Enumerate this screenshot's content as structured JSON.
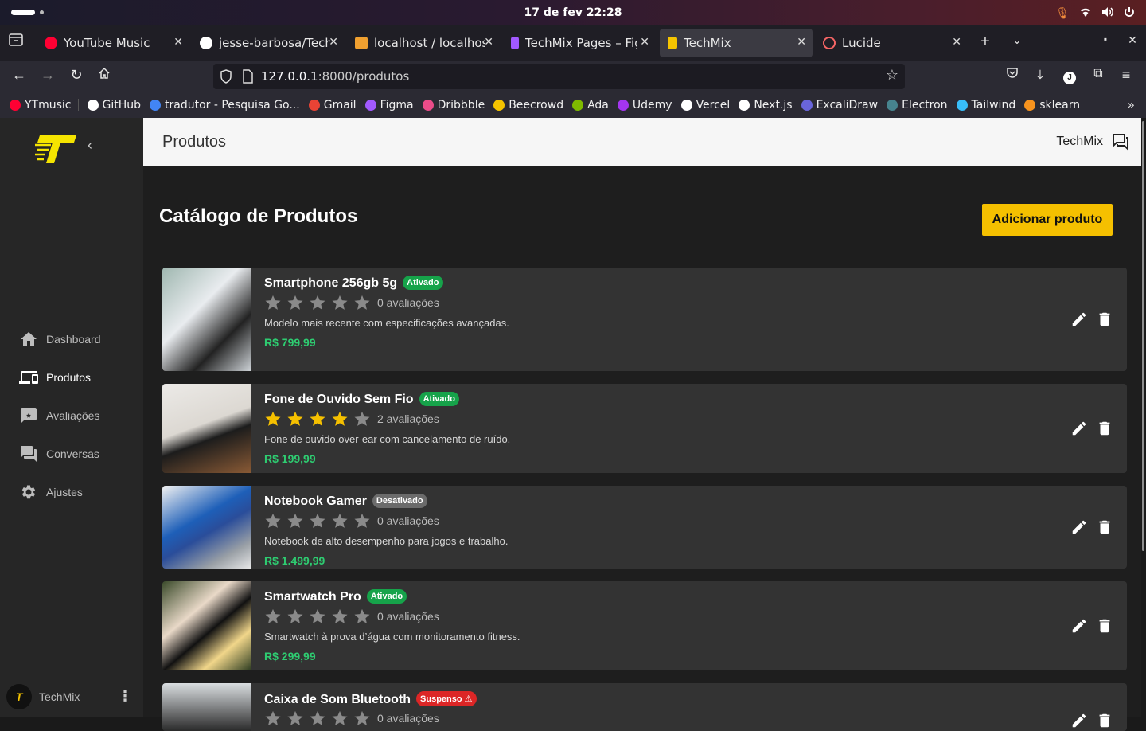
{
  "os_bar": {
    "clock": "17 de fev  22:28"
  },
  "tabs": [
    {
      "title": "YouTube Music",
      "color": "#ff0033"
    },
    {
      "title": "jesse-barbosa/TechMix",
      "color": "#ffffff"
    },
    {
      "title": "localhost / localhost / te",
      "color": "#f0a030"
    },
    {
      "title": "TechMix Pages – Figma",
      "color": "#a259ff"
    },
    {
      "title": "TechMix",
      "color": "#f5c400"
    },
    {
      "title": "Lucide",
      "color": "#f56565"
    }
  ],
  "address": {
    "host": "127.0.0.1",
    "path": ":8000/produtos"
  },
  "bookmarks": [
    {
      "label": "YTmusic",
      "color": "#ff0033"
    },
    {
      "label": "GitHub",
      "color": "#ffffff"
    },
    {
      "label": "tradutor - Pesquisa Go...",
      "color": "#4285f4"
    },
    {
      "label": "Gmail",
      "color": "#ea4335"
    },
    {
      "label": "Figma",
      "color": "#a259ff"
    },
    {
      "label": "Dribbble",
      "color": "#ea4c89"
    },
    {
      "label": "Beecrowd",
      "color": "#f5c400"
    },
    {
      "label": "Ada",
      "color": "#7fba00"
    },
    {
      "label": "Udemy",
      "color": "#a435f0"
    },
    {
      "label": "Vercel",
      "color": "#ffffff"
    },
    {
      "label": "Next.js",
      "color": "#ffffff"
    },
    {
      "label": "ExcaliDraw",
      "color": "#6965db"
    },
    {
      "label": "Electron",
      "color": "#47848f"
    },
    {
      "label": "Tailwind",
      "color": "#38bdf8"
    },
    {
      "label": "sklearn",
      "color": "#f7931e"
    }
  ],
  "sidebar": {
    "items": [
      {
        "label": "Dashboard",
        "icon": "home-icon"
      },
      {
        "label": "Produtos",
        "icon": "devices-icon"
      },
      {
        "label": "Avaliações",
        "icon": "rate-review-icon"
      },
      {
        "label": "Conversas",
        "icon": "forum-icon"
      },
      {
        "label": "Ajustes",
        "icon": "settings-icon"
      }
    ],
    "user": "TechMix"
  },
  "header": {
    "title": "Produtos",
    "brand": "TechMix"
  },
  "catalog": {
    "title": "Catálogo de Produtos",
    "add_button": "Adicionar produto",
    "products": [
      {
        "name": "Smartphone 256gb 5g",
        "status": "Ativado",
        "status_color": "#16a34a",
        "rating": 0,
        "reviews": "0 avaliações",
        "description": "Modelo mais recente com especificações avançadas.",
        "price": "R$ 799,99"
      },
      {
        "name": "Fone de Ouvido Sem Fio",
        "status": "Ativado",
        "status_color": "#16a34a",
        "rating": 4,
        "reviews": "2 avaliações",
        "description": "Fone de ouvido over-ear com cancelamento de ruído.",
        "price": "R$ 199,99"
      },
      {
        "name": "Notebook Gamer",
        "status": "Desativado",
        "status_color": "#6b6b6b",
        "rating": 0,
        "reviews": "0 avaliações",
        "description": "Notebook de alto desempenho para jogos e trabalho.",
        "price": "R$ 1.499,99"
      },
      {
        "name": "Smartwatch Pro",
        "status": "Ativado",
        "status_color": "#16a34a",
        "rating": 0,
        "reviews": "0 avaliações",
        "description": "Smartwatch à prova d’água com monitoramento fitness.",
        "price": "R$ 299,99"
      },
      {
        "name": "Caixa de Som Bluetooth",
        "status": "Suspenso",
        "status_color": "#dc2626",
        "rating": 0,
        "reviews": "0 avaliações",
        "description": "",
        "price": ""
      }
    ]
  },
  "colors": {
    "accent": "#f5c000",
    "price": "#2ecc71",
    "star_on": "#f5c000",
    "star_off": "#8a8a8a"
  }
}
